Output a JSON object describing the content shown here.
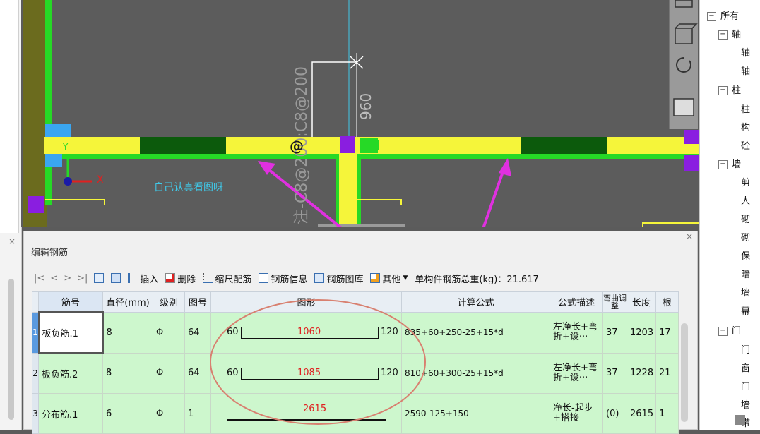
{
  "canvas": {
    "annotation": "自己认真看图呀",
    "rebar_vertical_label": "注-C8@200:C8@200",
    "dimension_label": "960",
    "axis_x": "X",
    "axis_y": "Y",
    "symbol_at": "@",
    "colors": {
      "yellow": "#f5f53a",
      "green": "#26d926",
      "darkgreen": "#0c5a0c",
      "purple": "#8a1ee0",
      "blue": "#3aa6f0",
      "magenta": "#e030e0",
      "cyan": "#40c8e8"
    }
  },
  "editor": {
    "title": "编辑钢筋",
    "close": "×",
    "toolbar": {
      "nav_first": "|<",
      "nav_prev": "<",
      "nav_next": ">",
      "nav_last": ">|",
      "insert": "插入",
      "delete": "删除",
      "scale_rebar": "缩尺配筋",
      "rebar_info": "钢筋信息",
      "rebar_library": "钢筋图库",
      "other": "其他",
      "total_weight": "单构件钢筋总重(kg)：21.617"
    },
    "columns": [
      "筋号",
      "直径(mm)",
      "级别",
      "图号",
      "图形",
      "计算公式",
      "公式描述",
      "弯曲调整",
      "长度",
      "根"
    ],
    "rows": [
      {
        "num": "1",
        "name": "板负筋.1",
        "dia": "8",
        "grade": "Φ",
        "fig": "64",
        "left": "60",
        "mid": "1060",
        "right": "120",
        "formula": "835+60+250-25+15*d",
        "desc1": "左净长+弯",
        "desc2": "折+设···",
        "bend": "37",
        "length": "1203",
        "count": "17"
      },
      {
        "num": "2",
        "name": "板负筋.2",
        "dia": "8",
        "grade": "Φ",
        "fig": "64",
        "left": "60",
        "mid": "1085",
        "right": "120",
        "formula": "810+60+300-25+15*d",
        "desc1": "左净长+弯",
        "desc2": "折+设···",
        "bend": "37",
        "length": "1228",
        "count": "21"
      },
      {
        "num": "3",
        "name": "分布筋.1",
        "dia": "6",
        "grade": "Φ",
        "fig": "1",
        "left": "",
        "mid": "2615",
        "right": "",
        "formula": "2590-125+150",
        "desc1": "净长-起步",
        "desc2": "+搭接",
        "bend": "(0)",
        "length": "2615",
        "count": "1"
      }
    ]
  },
  "tree": {
    "root": "所有",
    "items": [
      "轴",
      "轴",
      "轴",
      "柱",
      "柱",
      "构",
      "砼",
      "墙",
      "剪",
      "人",
      "砌",
      "砌",
      "保",
      "暗",
      "墙",
      "幕",
      "门",
      "门",
      "窗",
      "门",
      "墙",
      "带"
    ]
  }
}
